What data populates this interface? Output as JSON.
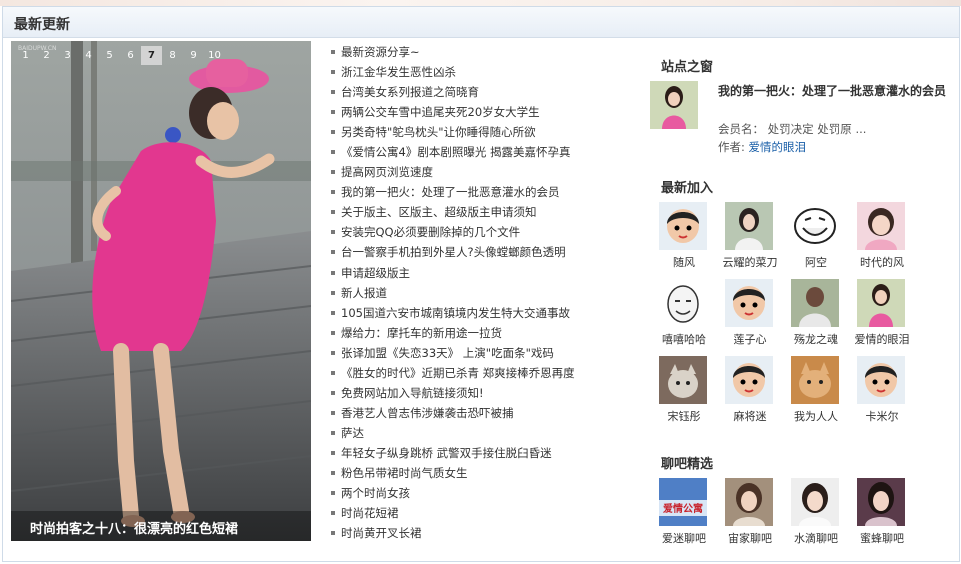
{
  "header": {
    "title": "最新更新"
  },
  "slideshow": {
    "tabs": [
      "1",
      "2",
      "3",
      "4",
      "5",
      "6",
      "7",
      "8",
      "9",
      "10"
    ],
    "active_tab": "7",
    "caption": "时尚拍客之十八：很漂亮的红色短裙"
  },
  "news": [
    "最新资源分享~",
    "浙江金华发生恶性凶杀",
    "台湾美女系列报道之简晓育",
    "两辆公交车雪中追尾夹死20岁女大学生",
    "另类奇特\"鸵鸟枕头\"让你睡得随心所欲",
    "《爱情公寓4》剧本剧照曝光 揭露美嘉怀孕真",
    "提高网页浏览速度",
    "我的第一把火：处理了一批恶意灌水的会员",
    "关于版主、区版主、超级版主申请须知",
    "安装完QQ必须要删除掉的几个文件",
    "台一警察手机拍到外星人?头像螳螂颜色透明",
    "申请超级版主",
    "新人报道",
    "105国道六安市城南镇境内发生特大交通事故",
    "爆给力：摩托车的新用途一拉货",
    "张译加盟《失恋33天》 上演\"吃面条\"戏码",
    "《胜女的时代》近期已杀青 郑爽接棒乔恩再度",
    "免费网站加入导航链接须知!",
    "香港艺人曾志伟涉嫌袭击恐吓被捕",
    "萨达",
    "年轻女子纵身跳桥 武警双手接住脱臼昏迷",
    "粉色吊带裙时尚气质女生",
    "两个时尚女孩",
    "时尚花短裙",
    "时尚黄开叉长裙"
  ],
  "site_window": {
    "title": "站点之窗",
    "featured_title": "我的第一把火：处理了一批恶意灌水的会员",
    "member_label": "会员名：",
    "member_value": "处罚决定 处罚原 ...",
    "author_label": "作者:",
    "author_value": "爱情的眼泪"
  },
  "newest": {
    "title": "最新加入",
    "members": [
      "随风",
      "云耀的菜刀",
      "阿空",
      "时代的风",
      "嘻嘻哈哈",
      "莲子心",
      "殇龙之魂",
      "爱情的眼泪",
      "宋钰彤",
      "麻将迷",
      "我为人人",
      "卡米尔"
    ]
  },
  "chat": {
    "title": "聊吧精选",
    "items": [
      "爱迷聊吧",
      "宙家聊吧",
      "水滴聊吧",
      "蜜蜂聊吧"
    ],
    "banner_text": "爱情公寓"
  }
}
